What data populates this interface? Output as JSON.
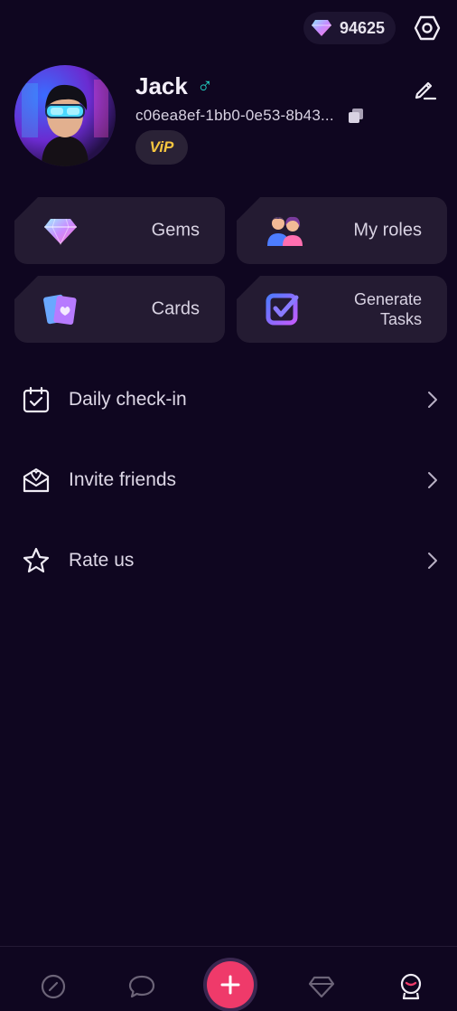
{
  "header": {
    "gem_count": "94625"
  },
  "profile": {
    "name": "Jack",
    "gender_symbol": "♂",
    "user_id": "c06ea8ef-1bb0-0e53-8b43...",
    "badge": "ViP"
  },
  "quick_cards": [
    {
      "label": "Gems",
      "icon": "gem-icon"
    },
    {
      "label": "My roles",
      "icon": "people-icon"
    },
    {
      "label": "Cards",
      "icon": "cards-icon"
    },
    {
      "label_line1": "Generate",
      "label_line2": "Tasks",
      "icon": "task-check-icon"
    }
  ],
  "menu": [
    {
      "label": "Daily check-in",
      "icon": "calendar-check-icon"
    },
    {
      "label": "Invite friends",
      "icon": "envelope-heart-icon"
    },
    {
      "label": "Rate us",
      "icon": "star-icon"
    }
  ],
  "tabbar": {
    "items": [
      "explore-icon",
      "chat-icon",
      "create-button",
      "gem-outline-icon",
      "profile-icon"
    ]
  },
  "colors": {
    "background": "#0f0620",
    "card": "#241b32",
    "accent_pink": "#ef3a6a",
    "vip_gold": "#f6c640",
    "male_teal": "#22d3c5"
  }
}
